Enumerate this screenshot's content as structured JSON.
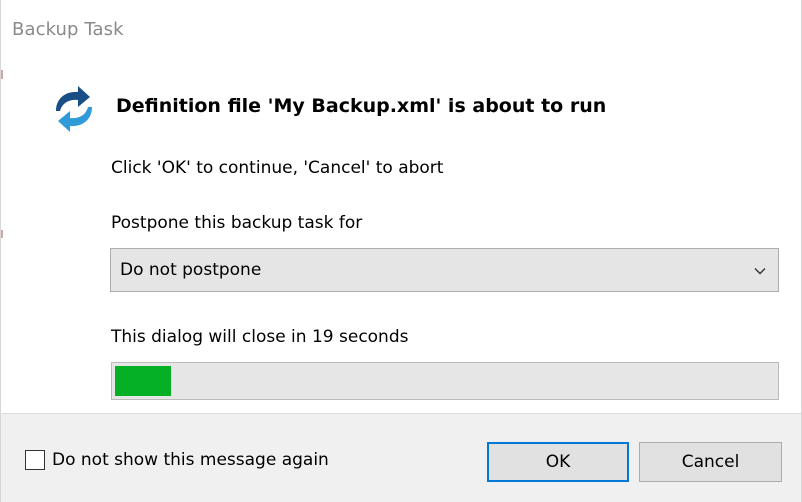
{
  "window": {
    "title": "Backup Task"
  },
  "message": {
    "heading": "Definition file 'My Backup.xml' is about to run",
    "instruction": "Click 'OK' to continue, 'Cancel' to abort"
  },
  "postpone": {
    "label": "Postpone this backup task for",
    "selected": "Do not postpone"
  },
  "countdown": {
    "text": "This dialog will close in 19 seconds",
    "progress_fraction": 0.085
  },
  "footer": {
    "checkbox_label": "Do not show this message again",
    "checkbox_checked": false,
    "ok_label": "OK",
    "cancel_label": "Cancel"
  },
  "icons": {
    "app": "sync-arrows-icon",
    "dropdown": "chevron-down-icon"
  },
  "colors": {
    "progress_fill": "#06b025",
    "icon_blue_dark": "#1a4f86",
    "icon_blue_light": "#2f9bd9",
    "focus_border": "#0078d7"
  }
}
